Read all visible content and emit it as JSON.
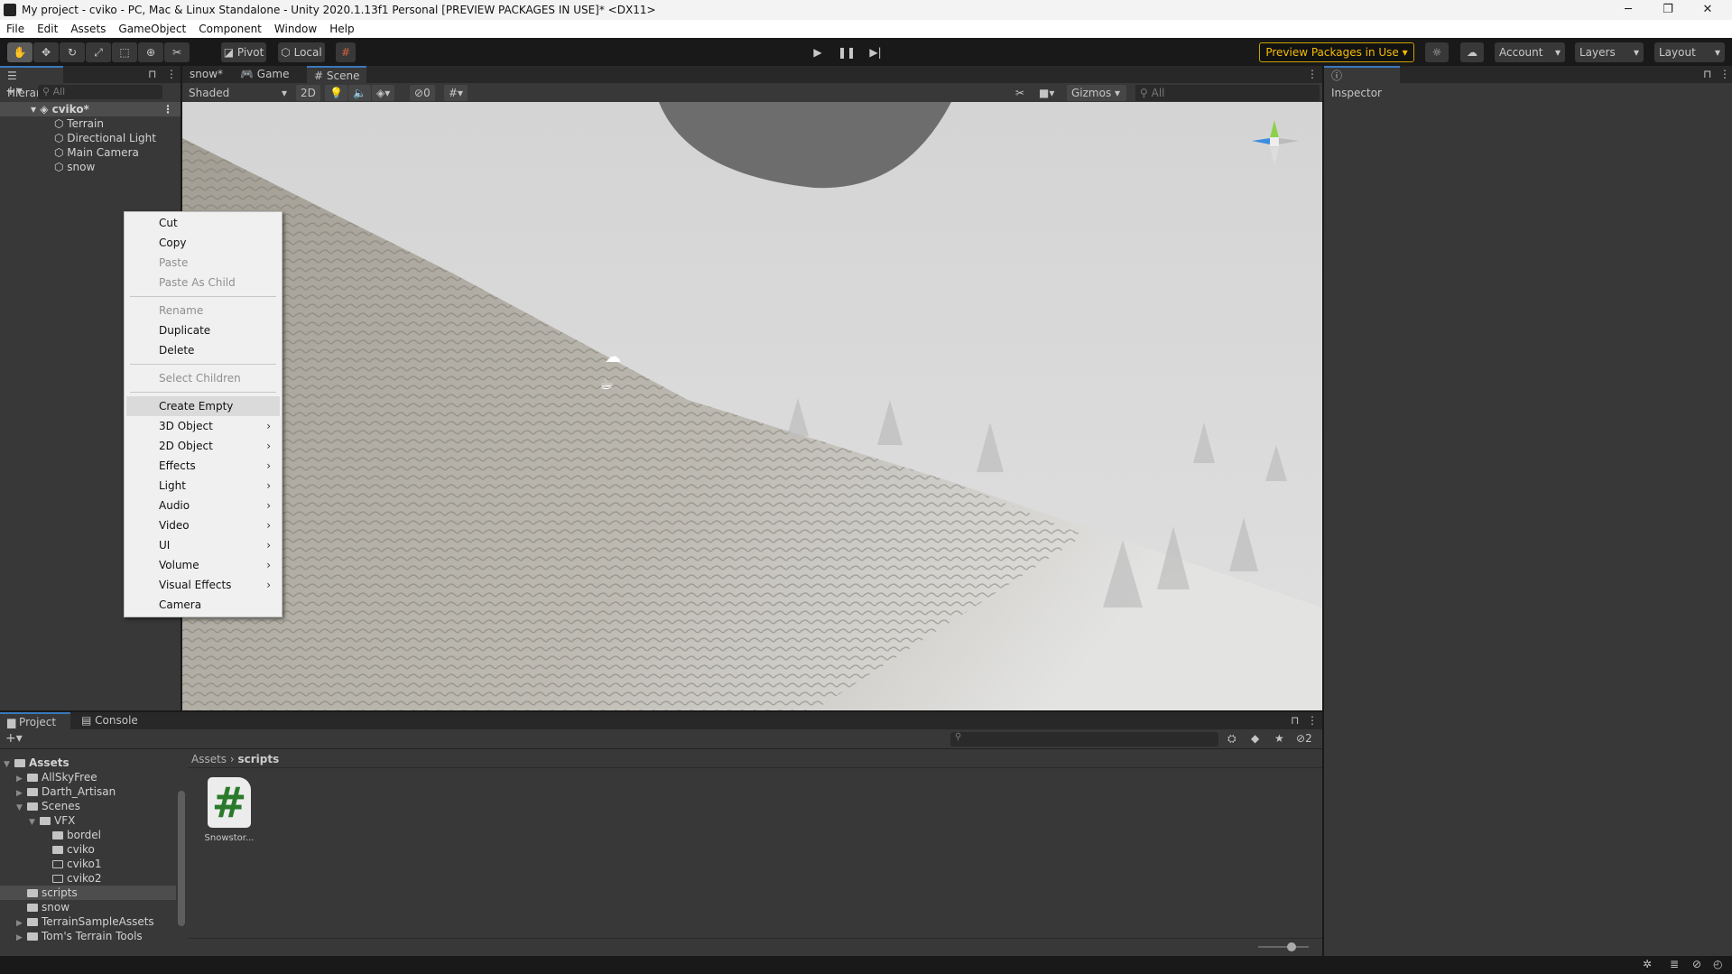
{
  "window": {
    "title": "My project - cviko - PC, Mac & Linux Standalone - Unity 2020.1.13f1 Personal [PREVIEW PACKAGES IN USE]* <DX11>"
  },
  "menu": [
    "File",
    "Edit",
    "Assets",
    "GameObject",
    "Component",
    "Window",
    "Help"
  ],
  "toolbar": {
    "pivot": "Pivot",
    "local": "Local",
    "preview": "Preview Packages in Use",
    "account": "Account",
    "layers": "Layers",
    "layout": "Layout",
    "accent": "#f4bc02"
  },
  "hierarchy": {
    "tab": "Hierarchy",
    "search_placeholder": "All",
    "scene": "cviko*",
    "items": [
      "Terrain",
      "Directional Light",
      "Main Camera",
      "snow"
    ]
  },
  "scene": {
    "tabs": [
      "snow*",
      "Game",
      "Scene"
    ],
    "shading": "Shaded",
    "mode2d": "2D",
    "hidden_count": "0",
    "gizmos": "Gizmos",
    "search_placeholder": "All"
  },
  "inspector": {
    "tab": "Inspector"
  },
  "context_menu": [
    {
      "label": "Cut",
      "enabled": true
    },
    {
      "label": "Copy",
      "enabled": true
    },
    {
      "label": "Paste",
      "enabled": false
    },
    {
      "label": "Paste As Child",
      "enabled": false
    },
    {
      "sep": true
    },
    {
      "label": "Rename",
      "enabled": false
    },
    {
      "label": "Duplicate",
      "enabled": true
    },
    {
      "label": "Delete",
      "enabled": true
    },
    {
      "sep": true
    },
    {
      "label": "Select Children",
      "enabled": false
    },
    {
      "sep": true
    },
    {
      "label": "Create Empty",
      "enabled": true,
      "highlight": true
    },
    {
      "label": "3D Object",
      "enabled": true,
      "sub": true
    },
    {
      "label": "2D Object",
      "enabled": true,
      "sub": true
    },
    {
      "label": "Effects",
      "enabled": true,
      "sub": true
    },
    {
      "label": "Light",
      "enabled": true,
      "sub": true
    },
    {
      "label": "Audio",
      "enabled": true,
      "sub": true
    },
    {
      "label": "Video",
      "enabled": true,
      "sub": true
    },
    {
      "label": "UI",
      "enabled": true,
      "sub": true
    },
    {
      "label": "Volume",
      "enabled": true,
      "sub": true
    },
    {
      "label": "Visual Effects",
      "enabled": true,
      "sub": true
    },
    {
      "label": "Camera",
      "enabled": true
    }
  ],
  "project": {
    "tabs": [
      "Project",
      "Console"
    ],
    "breadcrumb": [
      "Assets",
      "scripts"
    ],
    "hidden_count": "2",
    "tree": [
      {
        "label": "Assets",
        "depth": 0,
        "arrow": "down",
        "bold": true,
        "open": true
      },
      {
        "label": "AllSkyFree",
        "depth": 1,
        "arrow": "right"
      },
      {
        "label": "Darth_Artisan",
        "depth": 1,
        "arrow": "right"
      },
      {
        "label": "Scenes",
        "depth": 1,
        "arrow": "down",
        "open": true
      },
      {
        "label": "VFX",
        "depth": 2,
        "arrow": "down",
        "open": true
      },
      {
        "label": "bordel",
        "depth": 3
      },
      {
        "label": "cviko",
        "depth": 3
      },
      {
        "label": "cviko1",
        "depth": 3,
        "empty": true
      },
      {
        "label": "cviko2",
        "depth": 3,
        "empty": true
      },
      {
        "label": "scripts",
        "depth": 1,
        "selected": true
      },
      {
        "label": "snow",
        "depth": 1
      },
      {
        "label": "TerrainSampleAssets",
        "depth": 1,
        "arrow": "right"
      },
      {
        "label": "Tom's Terrain Tools",
        "depth": 1,
        "arrow": "right"
      }
    ],
    "files": [
      {
        "name": "Snowstor...",
        "icon": "csharp-script-icon"
      }
    ]
  }
}
